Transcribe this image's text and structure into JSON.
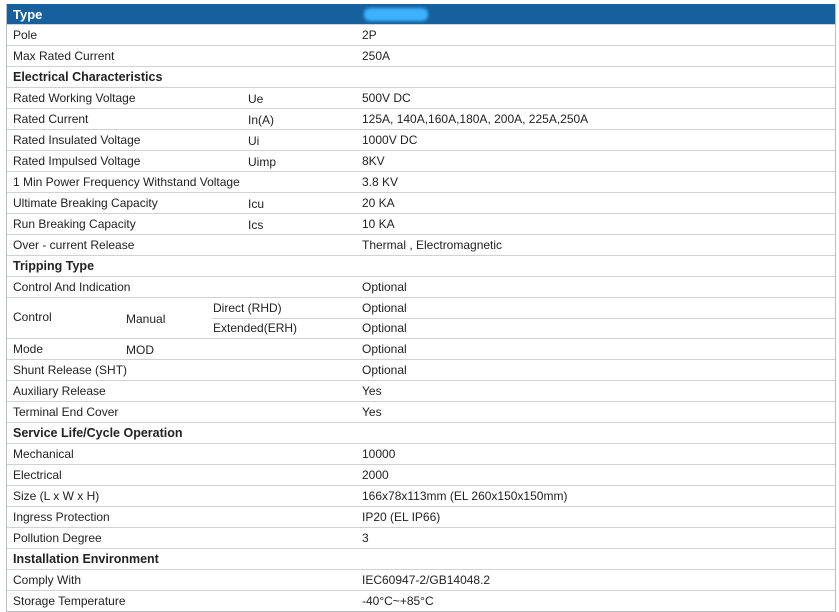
{
  "header": {
    "title": "Type"
  },
  "rows": [
    {
      "label": "Pole",
      "sym": "",
      "value": "2P"
    },
    {
      "label": "Max Rated Current",
      "sym": "",
      "value": "250A"
    },
    {
      "section": "Electrical Characteristics"
    },
    {
      "label": "Rated Working Voltage",
      "sym": "Ue",
      "value": "500V DC"
    },
    {
      "label": "Rated Current",
      "sym": "In(A)",
      "value": "125A, 140A,160A,180A, 200A, 225A,250A"
    },
    {
      "label": "Rated Insulated Voltage",
      "sym": "Ui",
      "value": "1000V DC"
    },
    {
      "label": "Rated Impulsed Voltage",
      "sym": "Uimp",
      "value": "8KV"
    },
    {
      "label": "1 Min Power Frequency Withstand Voltage",
      "sym": "",
      "value": "3.8 KV"
    },
    {
      "label": "Ultimate Breaking Capacity",
      "sym": "Icu",
      "value": "20 KA"
    },
    {
      "label": "Run Breaking Capacity",
      "sym": "Ics",
      "value": "10 KA"
    },
    {
      "label": "Over - current Release",
      "sym": "",
      "value": "Thermal , Electromagnetic"
    },
    {
      "section": "Tripping Type"
    },
    {
      "label": "Control And Indication",
      "sym": "",
      "value": "Optional"
    },
    {
      "dual": true,
      "label": "Control",
      "sub": "Manual",
      "d1": "Direct (RHD)",
      "v1": "Optional",
      "d2": "Extended(ERH)",
      "v2": "Optional"
    },
    {
      "label": "Mode",
      "sym": "MOD",
      "value": "Optional",
      "symPos": "mid"
    },
    {
      "label": "Shunt Release (SHT)",
      "sym": "",
      "value": "Optional"
    },
    {
      "label": "Auxiliary Release",
      "sym": "",
      "value": "Yes"
    },
    {
      "label": "Terminal End Cover",
      "sym": "",
      "value": "Yes"
    },
    {
      "section": "Service Life/Cycle Operation"
    },
    {
      "label": "Mechanical",
      "sym": "",
      "value": "10000"
    },
    {
      "label": "Electrical",
      "sym": "",
      "value": "2000"
    },
    {
      "label": "Size (L x W x H)",
      "sym": "",
      "value": "166x78x113mm (EL 260x150x150mm)"
    },
    {
      "label": "Ingress Protection",
      "sym": "",
      "value": "IP20 (EL IP66)"
    },
    {
      "label": "Pollution Degree",
      "sym": "",
      "value": "3"
    },
    {
      "section": "Installation Environment"
    },
    {
      "label": "Comply With",
      "sym": "",
      "value": "IEC60947-2/GB14048.2"
    },
    {
      "label": "Storage Temperature",
      "sym": "",
      "value": "-40°C~+85°C"
    }
  ]
}
